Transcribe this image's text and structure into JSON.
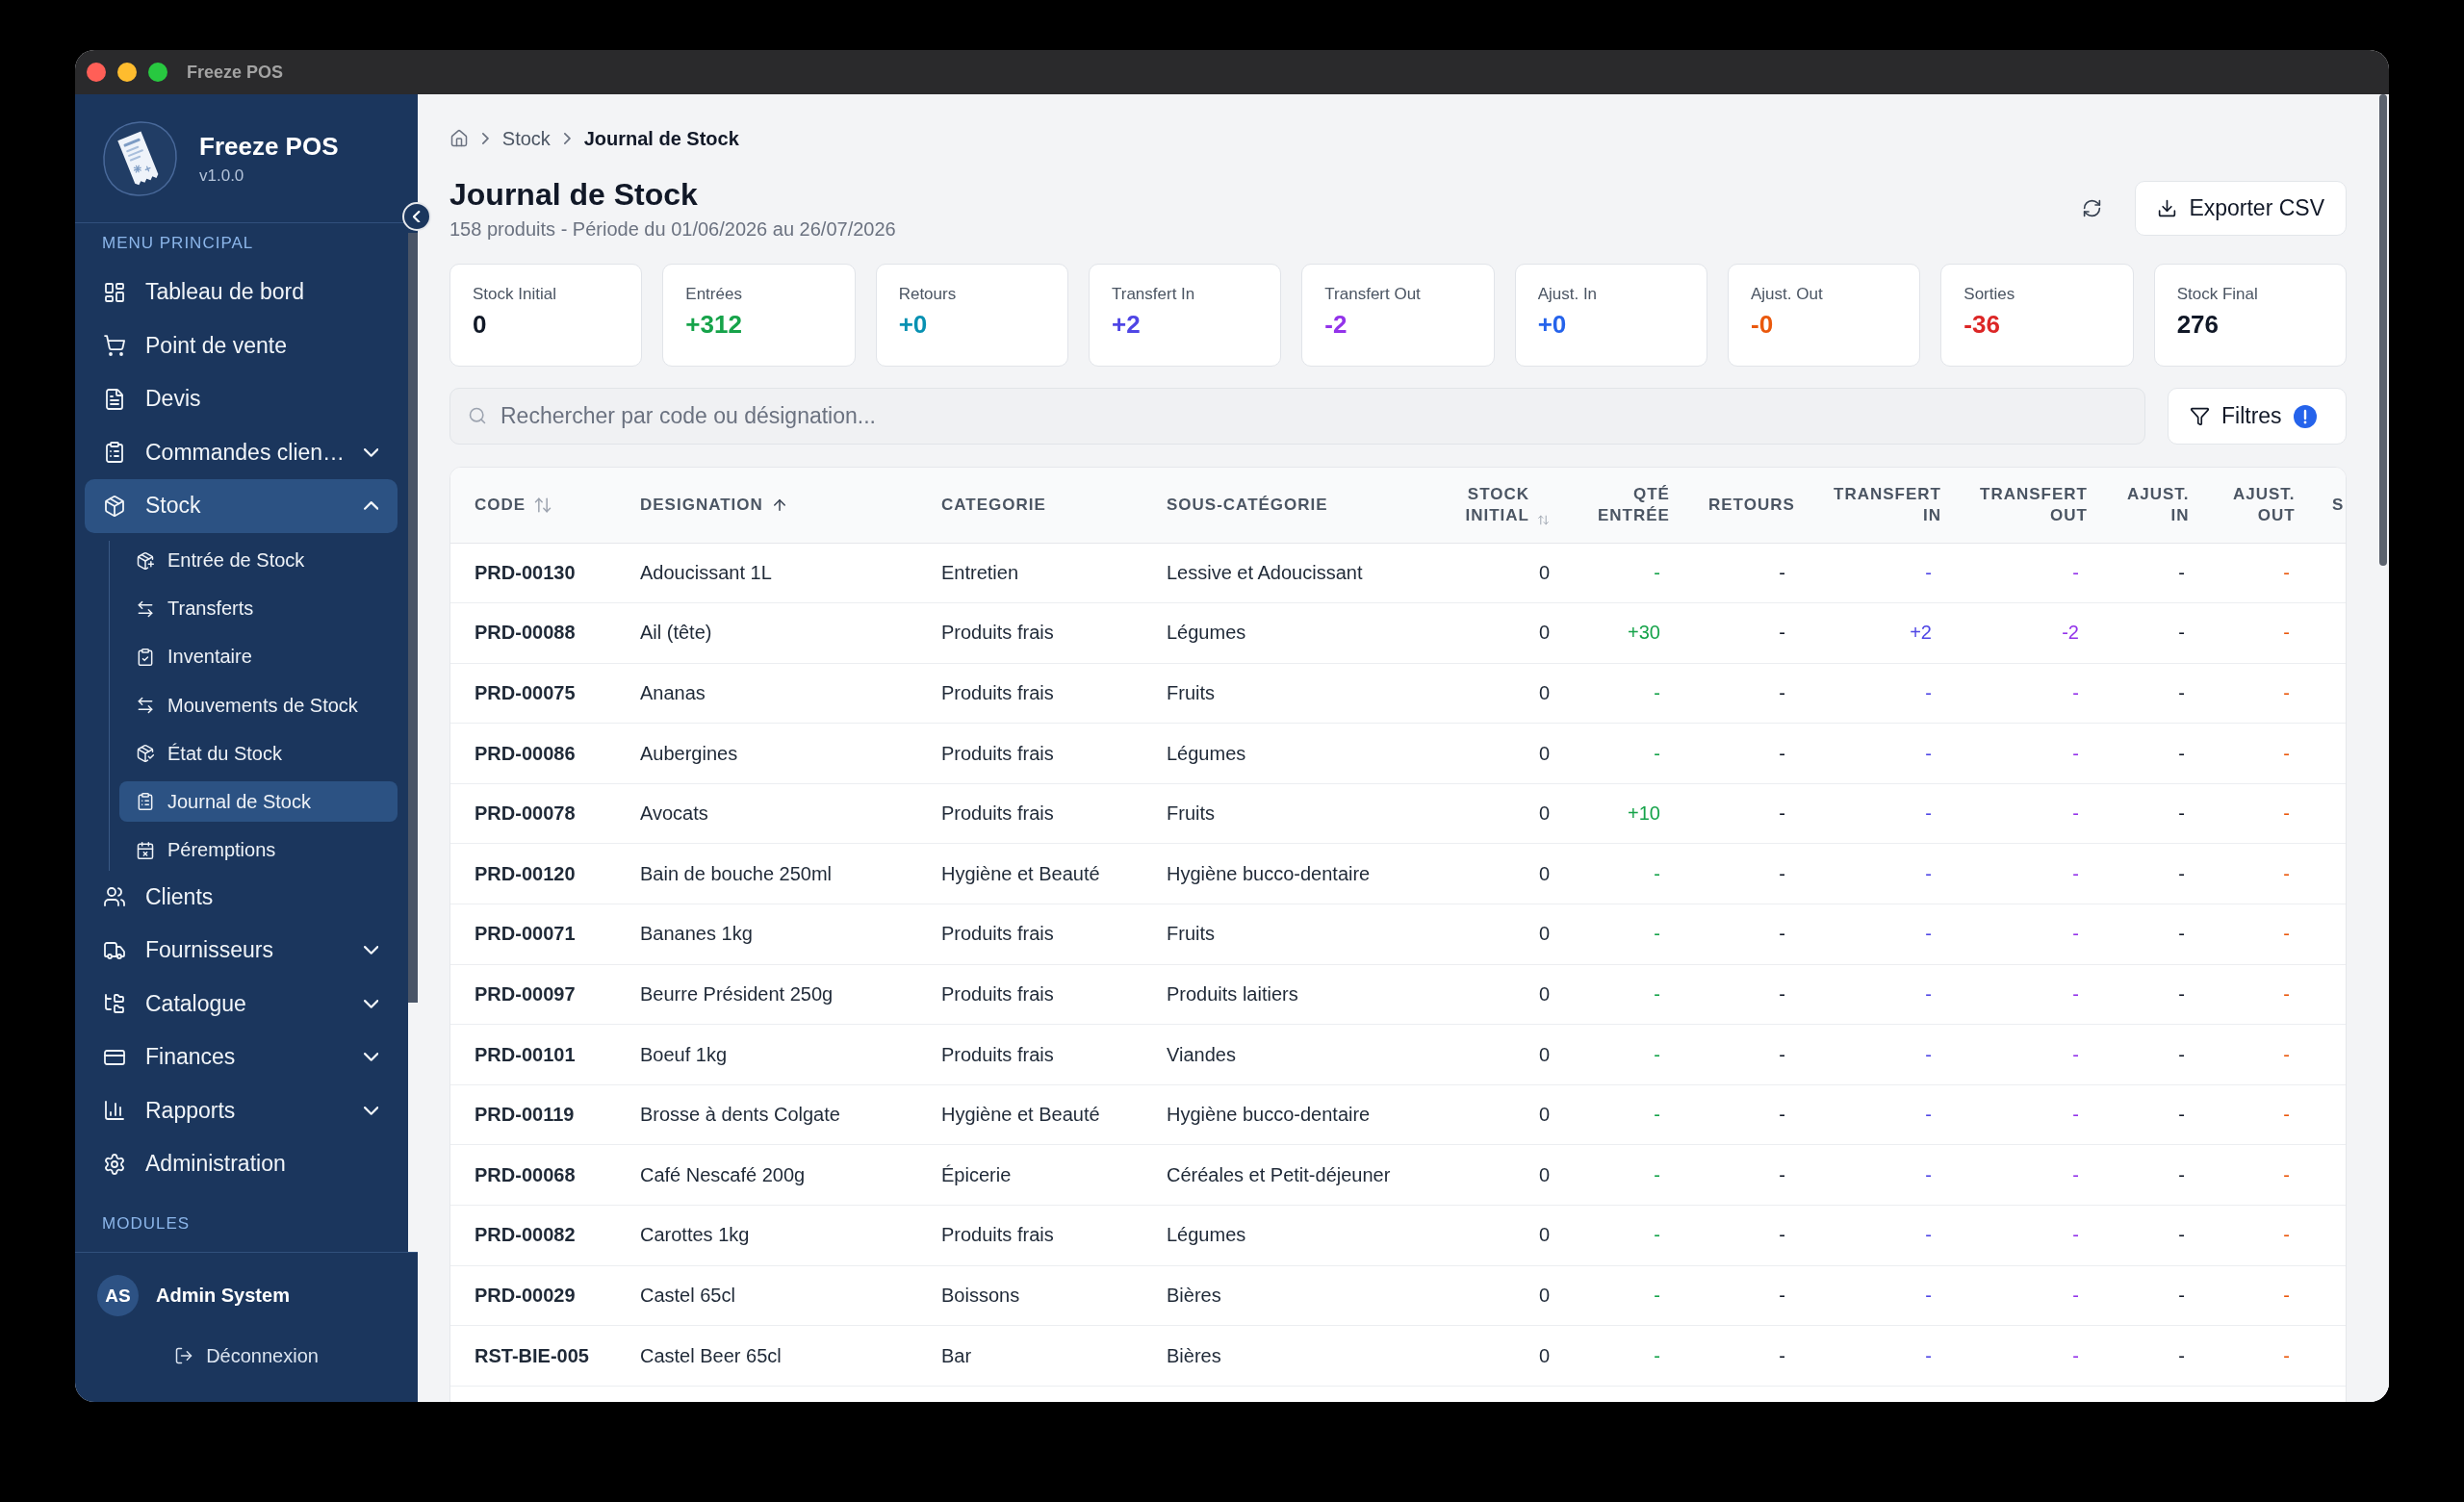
{
  "window": {
    "title": "Freeze POS"
  },
  "sidebar": {
    "app_name": "Freeze POS",
    "version": "v1.0.0",
    "sections": [
      {
        "label": "MENU PRINCIPAL",
        "items": [
          {
            "label": "Tableau de bord",
            "kind": "link",
            "selected": false
          },
          {
            "label": "Point de vente",
            "kind": "link",
            "selected": false
          },
          {
            "label": "Devis",
            "kind": "link",
            "selected": false
          },
          {
            "label": "Commandes clien…",
            "kind": "group",
            "expanded": false,
            "selected": false
          },
          {
            "label": "Stock",
            "kind": "group",
            "expanded": true,
            "selected": true,
            "children": [
              {
                "label": "Entrée de Stock",
                "selected": false
              },
              {
                "label": "Transferts",
                "selected": false
              },
              {
                "label": "Inventaire",
                "selected": false
              },
              {
                "label": "Mouvements de Stock",
                "selected": false
              },
              {
                "label": "État du Stock",
                "selected": false
              },
              {
                "label": "Journal de Stock",
                "selected": true
              },
              {
                "label": "Péremptions",
                "selected": false
              }
            ]
          },
          {
            "label": "Clients",
            "kind": "link",
            "selected": false
          },
          {
            "label": "Fournisseurs",
            "kind": "group",
            "expanded": false,
            "selected": false
          },
          {
            "label": "Catalogue",
            "kind": "group",
            "expanded": false,
            "selected": false
          },
          {
            "label": "Finances",
            "kind": "group",
            "expanded": false,
            "selected": false
          },
          {
            "label": "Rapports",
            "kind": "group",
            "expanded": false,
            "selected": false
          },
          {
            "label": "Administration",
            "kind": "link",
            "selected": false
          }
        ]
      },
      {
        "label": "MODULES"
      }
    ],
    "user": {
      "initials": "AS",
      "name": "Admin System"
    },
    "logout": "Déconnexion"
  },
  "breadcrumb": [
    "Stock",
    "Journal de Stock"
  ],
  "header": {
    "title": "Journal de Stock",
    "subtitle": "158 produits - Période du 01/06/2026 au 26/07/2026",
    "export_button": "Exporter CSV"
  },
  "stats": [
    {
      "label": "Stock Initial",
      "value": "0",
      "color": "#111827"
    },
    {
      "label": "Entrées",
      "value": "+312",
      "color": "#16a34a"
    },
    {
      "label": "Retours",
      "value": "+0",
      "color": "#0891b2"
    },
    {
      "label": "Transfert In",
      "value": "+2",
      "color": "#4f46e5"
    },
    {
      "label": "Transfert Out",
      "value": "-2",
      "color": "#9333ea"
    },
    {
      "label": "Ajust. In",
      "value": "+0",
      "color": "#2563eb"
    },
    {
      "label": "Ajust. Out",
      "value": "-0",
      "color": "#ea580c"
    },
    {
      "label": "Sorties",
      "value": "-36",
      "color": "#dc2626"
    },
    {
      "label": "Stock Final",
      "value": "276",
      "color": "#111827"
    }
  ],
  "search": {
    "placeholder": "Rechercher par code ou désignation..."
  },
  "filters": {
    "label": "Filtres",
    "active": true
  },
  "table": {
    "columns": [
      {
        "lines": [
          "CODE"
        ],
        "kind": "text",
        "sortable": true,
        "sorted": false
      },
      {
        "lines": [
          "DESIGNATION"
        ],
        "kind": "text",
        "sortable": true,
        "sorted": true
      },
      {
        "lines": [
          "CATEGORIE"
        ],
        "kind": "text",
        "sortable": false
      },
      {
        "lines": [
          "SOUS-CATÉGORIE"
        ],
        "kind": "text",
        "sortable": false
      },
      {
        "lines": [
          "STOCK",
          "INITIAL"
        ],
        "kind": "number",
        "sortable": true,
        "sorted": false
      },
      {
        "lines": [
          "QTÉ",
          "ENTRÉE"
        ],
        "kind": "number",
        "sortable": false,
        "color": "#16a34a"
      },
      {
        "lines": [
          "RETOURS"
        ],
        "kind": "number",
        "sortable": false,
        "color": "#111827"
      },
      {
        "lines": [
          "TRANSFERT",
          "IN"
        ],
        "kind": "number",
        "sortable": false,
        "color": "#4f46e5"
      },
      {
        "lines": [
          "TRANSFERT",
          "OUT"
        ],
        "kind": "number",
        "sortable": false,
        "color": "#9333ea"
      },
      {
        "lines": [
          "AJUST.",
          "IN"
        ],
        "kind": "number",
        "sortable": false,
        "color": "#111827"
      },
      {
        "lines": [
          "AJUST.",
          "OUT"
        ],
        "kind": "number",
        "sortable": false,
        "color": "#ea580c"
      },
      {
        "lines": [
          "S"
        ],
        "kind": "text"
      }
    ],
    "rows": [
      {
        "cells": [
          "PRD-00130",
          "Adoucissant 1L",
          "Entretien",
          "Lessive et Adoucissant",
          "0",
          "-",
          "-",
          "-",
          "-",
          "-",
          "-"
        ]
      },
      {
        "cells": [
          "PRD-00088",
          "Ail (tête)",
          "Produits frais",
          "Légumes",
          "0",
          "+30",
          "-",
          "+2",
          "-2",
          "-",
          "-"
        ]
      },
      {
        "cells": [
          "PRD-00075",
          "Ananas",
          "Produits frais",
          "Fruits",
          "0",
          "-",
          "-",
          "-",
          "-",
          "-",
          "-"
        ]
      },
      {
        "cells": [
          "PRD-00086",
          "Aubergines",
          "Produits frais",
          "Légumes",
          "0",
          "-",
          "-",
          "-",
          "-",
          "-",
          "-"
        ]
      },
      {
        "cells": [
          "PRD-00078",
          "Avocats",
          "Produits frais",
          "Fruits",
          "0",
          "+10",
          "-",
          "-",
          "-",
          "-",
          "-"
        ]
      },
      {
        "cells": [
          "PRD-00120",
          "Bain de bouche 250ml",
          "Hygiène et Beauté",
          "Hygiène bucco-dentaire",
          "0",
          "-",
          "-",
          "-",
          "-",
          "-",
          "-"
        ]
      },
      {
        "cells": [
          "PRD-00071",
          "Bananes 1kg",
          "Produits frais",
          "Fruits",
          "0",
          "-",
          "-",
          "-",
          "-",
          "-",
          "-"
        ]
      },
      {
        "cells": [
          "PRD-00097",
          "Beurre Président 250g",
          "Produits frais",
          "Produits laitiers",
          "0",
          "-",
          "-",
          "-",
          "-",
          "-",
          "-"
        ]
      },
      {
        "cells": [
          "PRD-00101",
          "Boeuf 1kg",
          "Produits frais",
          "Viandes",
          "0",
          "-",
          "-",
          "-",
          "-",
          "-",
          "-"
        ]
      },
      {
        "cells": [
          "PRD-00119",
          "Brosse à dents Colgate",
          "Hygiène et Beauté",
          "Hygiène bucco-dentaire",
          "0",
          "-",
          "-",
          "-",
          "-",
          "-",
          "-"
        ]
      },
      {
        "cells": [
          "PRD-00068",
          "Café Nescafé 200g",
          "Épicerie",
          "Céréales et Petit-déjeuner",
          "0",
          "-",
          "-",
          "-",
          "-",
          "-",
          "-"
        ]
      },
      {
        "cells": [
          "PRD-00082",
          "Carottes 1kg",
          "Produits frais",
          "Légumes",
          "0",
          "-",
          "-",
          "-",
          "-",
          "-",
          "-"
        ]
      },
      {
        "cells": [
          "PRD-00029",
          "Castel 65cl",
          "Boissons",
          "Bières",
          "0",
          "-",
          "-",
          "-",
          "-",
          "-",
          "-"
        ]
      },
      {
        "cells": [
          "RST-BIE-005",
          "Castel Beer 65cl",
          "Bar",
          "Bières",
          "0",
          "-",
          "-",
          "-",
          "-",
          "-",
          "-"
        ]
      }
    ]
  }
}
